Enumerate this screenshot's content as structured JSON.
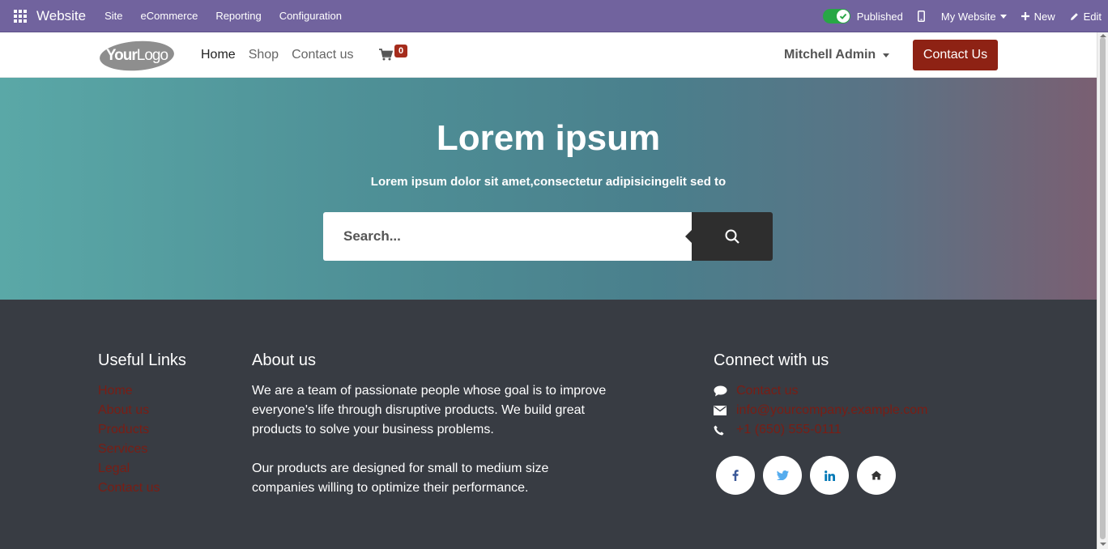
{
  "admin_bar": {
    "brand": "Website",
    "menu": [
      "Site",
      "eCommerce",
      "Reporting",
      "Configuration"
    ],
    "published_label": "Published",
    "published_state": true,
    "website_selector": "My Website",
    "new_label": "New",
    "edit_label": "Edit"
  },
  "navbar": {
    "logo_text": "YourLogo",
    "links": [
      "Home",
      "Shop",
      "Contact us"
    ],
    "active_link": "Home",
    "cart_count": "0",
    "user_name": "Mitchell Admin",
    "contact_button": "Contact Us"
  },
  "hero": {
    "title": "Lorem ipsum",
    "subtitle": "Lorem ipsum dolor sit amet,consectetur adipisicingelit sed to",
    "search_placeholder": "Search..."
  },
  "footer": {
    "useful_links": {
      "heading": "Useful Links",
      "items": [
        "Home",
        "About us",
        "Products",
        "Services",
        "Legal",
        "Contact us"
      ]
    },
    "about": {
      "heading": "About us",
      "paragraph1": "We are a team of passionate people whose goal is to improve everyone's life through disruptive products. We build great products to solve your business problems.",
      "paragraph2": "Our products are designed for small to medium size companies willing to optimize their performance."
    },
    "connect": {
      "heading": "Connect with us",
      "contact": "Contact us",
      "email": "info@yourcompany.example.com",
      "phone": "+1 (650) 555-0111",
      "socials": [
        "facebook-icon",
        "twitter-icon",
        "linkedin-icon",
        "home-icon"
      ]
    }
  },
  "colors": {
    "admin_bar": "#71639e",
    "accent": "#8e2214",
    "footer_bg": "#383c43",
    "footer_link": "#7a1d14",
    "toggle_on": "#28a745"
  }
}
